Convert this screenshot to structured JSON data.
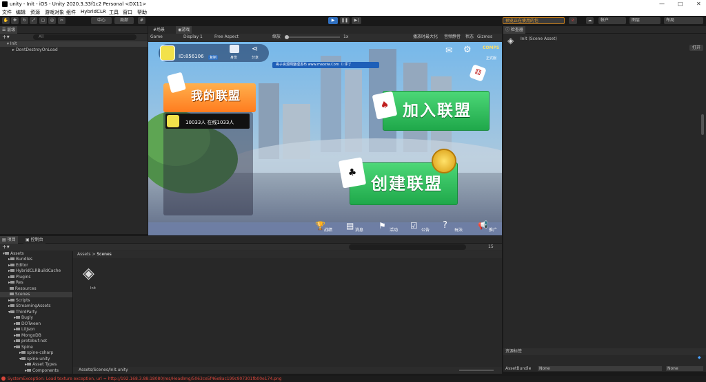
{
  "window": {
    "title": "unity - Init - iOS - Unity 2020.3.33f1c2 Personal <DX11>",
    "minimize": "—",
    "maximize": "□",
    "close": "✕"
  },
  "menu": [
    "文件",
    "编辑",
    "资源",
    "游戏对象",
    "组件",
    "HybridCLR",
    "工具",
    "窗口",
    "帮助"
  ],
  "toolbar": {
    "center": "中心",
    "local": "局部",
    "status": "预览正在使用的包",
    "account": "帐户",
    "layers": "图层",
    "layout": "布局"
  },
  "hierarchy": {
    "tab": "层级",
    "search": "All",
    "items": [
      "Init",
      "DontDestroyOnLoad"
    ]
  },
  "scene_tabs": {
    "scene": "场景",
    "game": "游戏"
  },
  "game_bar": {
    "display_mode": "Game",
    "display": "Display 1",
    "aspect": "Free Aspect",
    "scale_label": "缩放",
    "scale_value": "1x",
    "maximize": "播放时最大化",
    "mute": "音频静音",
    "stats": "状态",
    "gizmos": "Gizmos"
  },
  "game": {
    "id_text": "ID:856106",
    "copy": "复制",
    "identity": "身份",
    "share": "分享",
    "notice": "寄子资源网整理发布 www.maoziw.Com（i 评了",
    "my_union": "我的联盟",
    "union_info": "10033人  在线1033人",
    "join": "加入联盟",
    "create": "创建联盟",
    "logo": "COMPS",
    "logo_sub": "正式服",
    "bottom": [
      "战绩",
      "消息",
      "活动",
      "公告",
      "玩法",
      "推广"
    ]
  },
  "inspector": {
    "tab": "检查器",
    "asset": "Init (Scene Asset)",
    "open": "打开",
    "asset_labels": "资源标签",
    "asset_bundle": "AssetBundle",
    "bundle_val": "None",
    "variant_val": "None"
  },
  "project": {
    "tab": "项目",
    "console_tab": "控制台",
    "count": "15",
    "breadcrumb_root": "Assets",
    "breadcrumb_leaf": "Scenes",
    "path": "Assets/Scenes/Init.unity",
    "file": "Init",
    "tree": [
      "Assets",
      "Bundles",
      "Editor",
      "HybridCLRBuildCache",
      "Plugins",
      "Res",
      "Resources",
      "Scenes",
      "Scripts",
      "StreamingAssets",
      "ThirdParty",
      "Bugly",
      "DOTween",
      "LitJson",
      "MongoDB",
      "protobuf-net",
      "Spine",
      "spine-csharp",
      "spine-unity",
      "Asset Types",
      "Components"
    ]
  },
  "status": "SystemException: Load texture exception, url = http://192.168.3.88:18080/res/HeadImg/5063ce5f46e8ac199c907301fb00e174.png"
}
